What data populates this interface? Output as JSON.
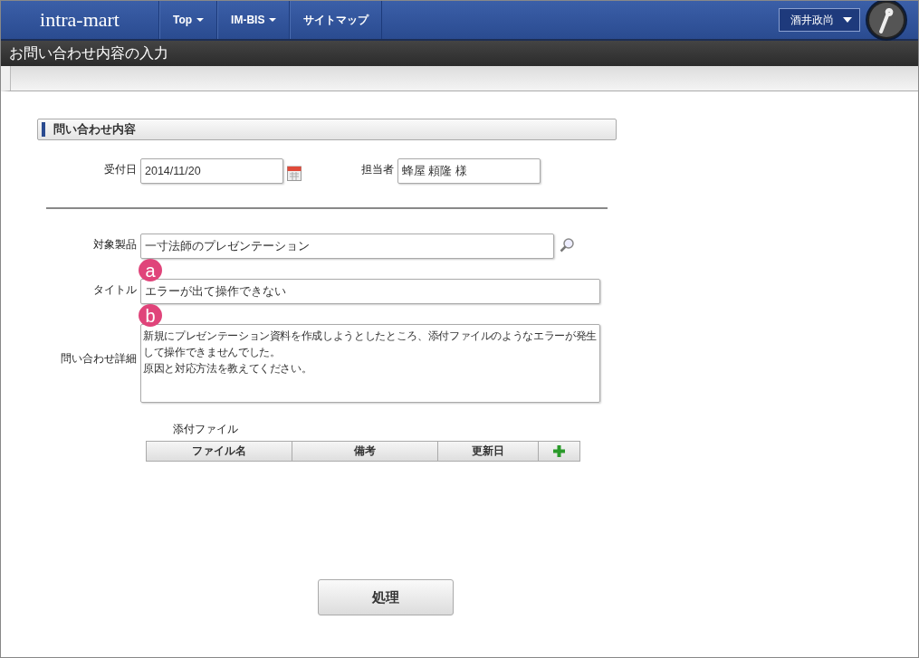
{
  "header": {
    "logo": "intra-mart",
    "nav": [
      {
        "label": "Top",
        "dropdown": true
      },
      {
        "label": "IM-BIS",
        "dropdown": true
      },
      {
        "label": "サイトマップ",
        "dropdown": false
      }
    ],
    "user": "酒井政尚"
  },
  "page_title": "お問い合わせ内容の入力",
  "section": {
    "title": "問い合わせ内容"
  },
  "form": {
    "date_label": "受付日",
    "date_value": "2014/11/20",
    "person_label": "担当者",
    "person_value": "蜂屋 頼隆 様",
    "product_label": "対象製品",
    "product_value": "一寸法師のプレゼンテーション",
    "title_label": "タイトル",
    "title_value": "エラーが出て操作できない",
    "title_marker": "a",
    "detail_label": "問い合わせ詳細",
    "detail_lines": [
      "新規にプレゼンテーション資料を作成しようとしたところ、添付ファイルのようなエラーが発生",
      "して操作できませんでした。",
      "原因と対応方法を教えてください。"
    ],
    "detail_marker": "b"
  },
  "attachments": {
    "label": "添付ファイル",
    "columns": [
      "ファイル名",
      "備考",
      "更新日"
    ]
  },
  "submit": "処理"
}
